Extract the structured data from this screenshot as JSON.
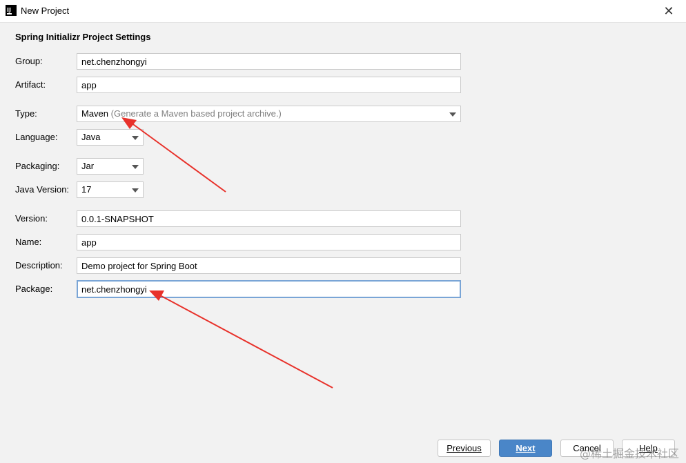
{
  "window": {
    "title": "New Project",
    "close_glyph": "✕"
  },
  "section_title": "Spring Initializr Project Settings",
  "fields": {
    "group": {
      "label": "Group:",
      "value": "net.chenzhongyi"
    },
    "artifact": {
      "label": "Artifact:",
      "value": "app"
    },
    "type": {
      "label": "Type:",
      "value": "Maven",
      "description": "(Generate a Maven based project archive.)"
    },
    "language": {
      "label": "Language:",
      "value": "Java"
    },
    "packaging": {
      "label": "Packaging:",
      "value": "Jar"
    },
    "java_version": {
      "label": "Java Version:",
      "value": "17"
    },
    "version": {
      "label": "Version:",
      "value": "0.0.1-SNAPSHOT"
    },
    "name": {
      "label": "Name:",
      "value": "app"
    },
    "description": {
      "label": "Description:",
      "value": "Demo project for Spring Boot"
    },
    "package": {
      "label": "Package:",
      "value": "net.chenzhongyi"
    }
  },
  "buttons": {
    "previous": "Previous",
    "next": "Next",
    "cancel": "Cancel",
    "help": "Help"
  },
  "watermark": "@稀土掘金技术社区",
  "annotation_color": "#e8312a"
}
